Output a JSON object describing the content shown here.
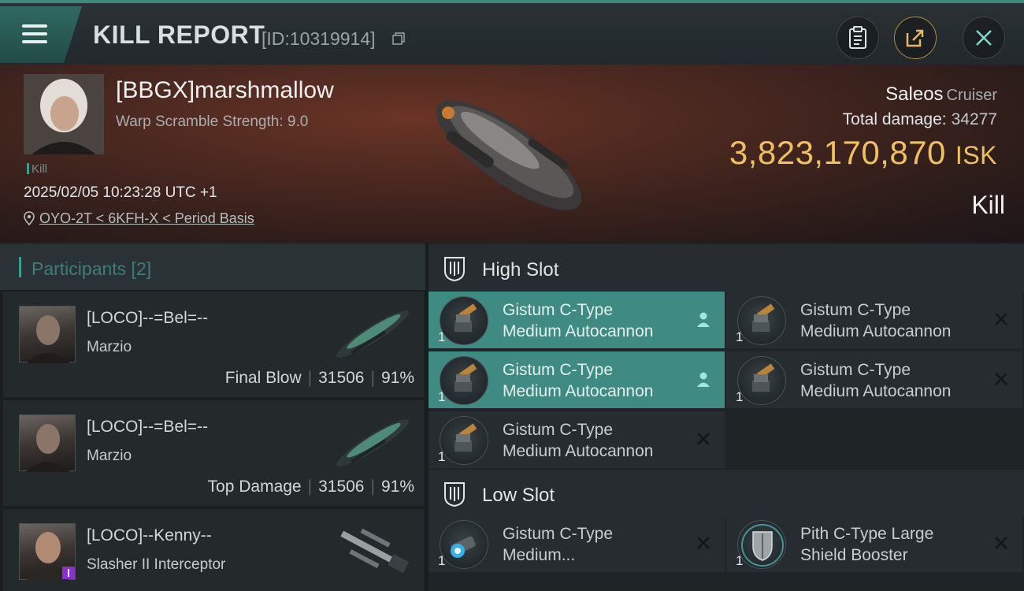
{
  "header": {
    "title": "KILL REPORT",
    "report_id": "[ID:10319914]"
  },
  "victim": {
    "name": "[BBGX]marshmallow",
    "warp_scramble": "Warp Scramble Strength: 9.0",
    "kill_tag": "Kill",
    "datetime": "2025/02/05 10:23:28 UTC +1",
    "location": "OYO-2T < 6KFH-X < Period Basis",
    "ship_name": "Saleos",
    "ship_class": "Cruiser",
    "total_damage_label": "Total damage:",
    "total_damage": "34277",
    "isk_value": "3,823,170,870",
    "isk_unit": "ISK",
    "result": "Kill"
  },
  "participants": {
    "label": "Participants [2]",
    "rows": [
      {
        "name": "[LOCO]--=Bel=--",
        "ship": "Marzio",
        "tag": "Final Blow",
        "damage": "31506",
        "percent": "91%"
      },
      {
        "name": "[LOCO]--=Bel=--",
        "ship": "Marzio",
        "tag": "Top Damage",
        "damage": "31506",
        "percent": "91%"
      },
      {
        "name": "[LOCO]--Kenny--",
        "ship": "Slasher II Interceptor"
      }
    ]
  },
  "slots": {
    "high": {
      "label": "High Slot",
      "modules": [
        {
          "line1": "Gistum C-Type",
          "line2": "Medium Autocannon",
          "qty": "1",
          "status": "pilot"
        },
        {
          "line1": "Gistum C-Type",
          "line2": "Medium Autocannon",
          "qty": "1",
          "status": "destroyed"
        },
        {
          "line1": "Gistum C-Type",
          "line2": "Medium Autocannon",
          "qty": "1",
          "status": "pilot"
        },
        {
          "line1": "Gistum C-Type",
          "line2": "Medium Autocannon",
          "qty": "1",
          "status": "destroyed"
        },
        {
          "line1": "Gistum C-Type",
          "line2": "Medium Autocannon",
          "qty": "1",
          "status": "destroyed"
        }
      ]
    },
    "low": {
      "label": "Low Slot",
      "modules": [
        {
          "line1": "Gistum C-Type",
          "line2": "Medium...",
          "qty": "1",
          "status": "destroyed"
        },
        {
          "line1": "Pith C-Type Large",
          "line2": "Shield Booster",
          "qty": "1",
          "status": "destroyed"
        }
      ]
    }
  },
  "colors": {
    "accent": "#3a9d92",
    "isk": "#f0c060",
    "active_module": "#3f8a82"
  }
}
